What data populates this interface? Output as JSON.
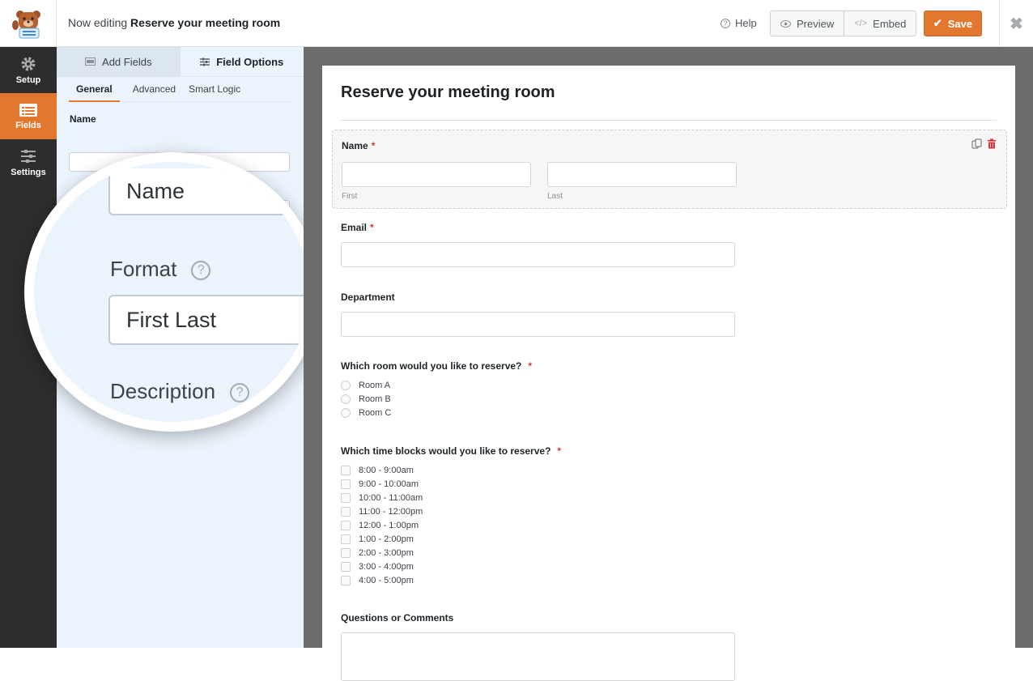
{
  "header": {
    "prefix": "Now editing",
    "form_name": "Reserve your meeting room",
    "help_label": "Help",
    "preview_label": "Preview",
    "embed_label": "Embed",
    "save_label": "Save",
    "accent": "#e27730"
  },
  "leftnav": {
    "items": [
      {
        "label": "Setup",
        "icon": "gear-icon"
      },
      {
        "label": "Fields",
        "icon": "fields-icon",
        "active": true
      },
      {
        "label": "Settings",
        "icon": "sliders-icon"
      }
    ]
  },
  "panel": {
    "tabs": [
      {
        "label": "Add Fields"
      },
      {
        "label": "Field Options"
      }
    ],
    "subtabs": [
      {
        "label": "General"
      },
      {
        "label": "Advanced"
      },
      {
        "label": "Smart Logic"
      }
    ],
    "label_field_label": "Name",
    "magnifier": {
      "label_value": "Name",
      "format_label": "Format",
      "format_value": "First Last",
      "description_label": "Description"
    }
  },
  "form": {
    "title": "Reserve your meeting room",
    "name_field": {
      "label": "Name",
      "first_sublabel": "First",
      "last_sublabel": "Last"
    },
    "email_field": {
      "label": "Email"
    },
    "department_field": {
      "label": "Department"
    },
    "room_field": {
      "label": "Which room would you like to reserve?",
      "options": [
        "Room A",
        "Room B",
        "Room C"
      ]
    },
    "time_field": {
      "label": "Which time blocks would you like to reserve?",
      "options": [
        "8:00 - 9:00am",
        "9:00 - 10:00am",
        "10:00 - 11:00am",
        "11:00 - 12:00pm",
        "12:00 - 1:00pm",
        "1:00 - 2:00pm",
        "2:00 - 3:00pm",
        "3:00 - 4:00pm",
        "4:00 - 5:00pm"
      ]
    },
    "comments_field": {
      "label": "Questions or Comments"
    },
    "required_mark": "*"
  }
}
